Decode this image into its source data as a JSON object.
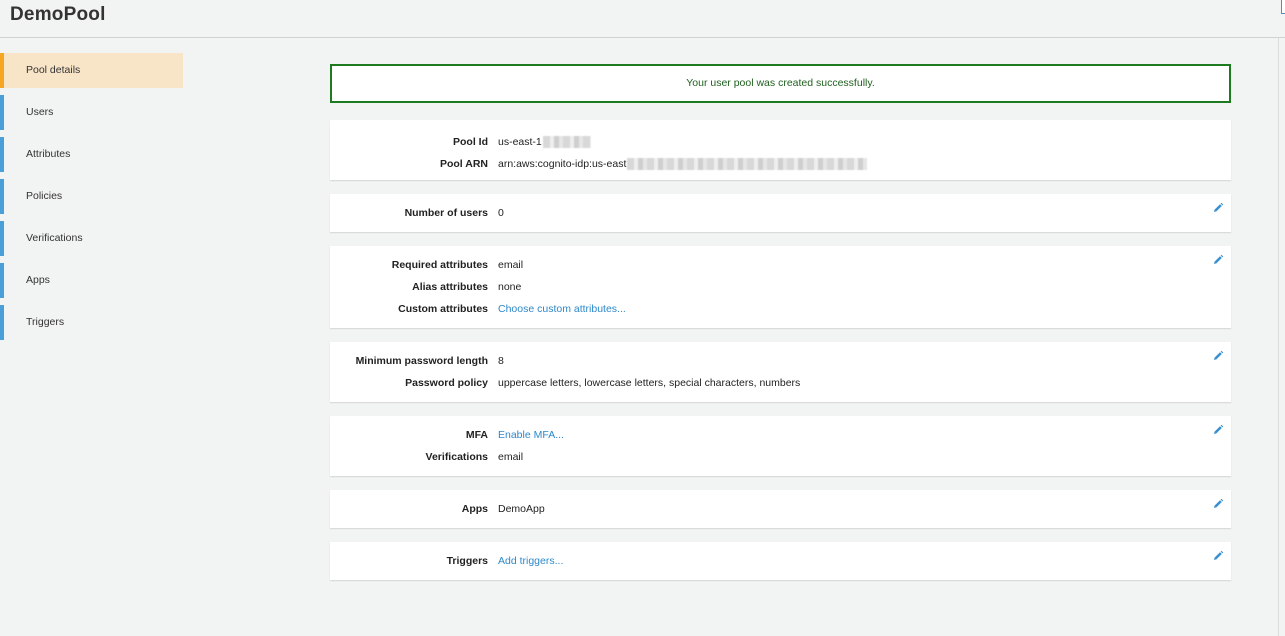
{
  "header": {
    "title": "DemoPool"
  },
  "sidebar": {
    "items": [
      {
        "label": "Pool details",
        "active": true
      },
      {
        "label": "Users"
      },
      {
        "label": "Attributes"
      },
      {
        "label": "Policies"
      },
      {
        "label": "Verifications"
      },
      {
        "label": "Apps"
      },
      {
        "label": "Triggers"
      }
    ]
  },
  "alert": {
    "message": "Your user pool was created successfully."
  },
  "pool": {
    "id_label": "Pool Id",
    "id_value": "us-east-1",
    "arn_label": "Pool ARN",
    "arn_value": "arn:aws:cognito-idp:us-east"
  },
  "users": {
    "label": "Number of users",
    "value": "0"
  },
  "attributes": {
    "required_label": "Required attributes",
    "required_value": "email",
    "alias_label": "Alias attributes",
    "alias_value": "none",
    "custom_label": "Custom attributes",
    "custom_link": "Choose custom attributes..."
  },
  "password": {
    "min_label": "Minimum password length",
    "min_value": "8",
    "policy_label": "Password policy",
    "policy_value": "uppercase letters, lowercase letters, special characters, numbers"
  },
  "mfa": {
    "mfa_label": "MFA",
    "mfa_link": "Enable MFA...",
    "verifications_label": "Verifications",
    "verifications_value": "email"
  },
  "apps": {
    "label": "Apps",
    "value": "DemoApp"
  },
  "triggers": {
    "label": "Triggers",
    "link": "Add triggers..."
  },
  "colors": {
    "accent": "#4a9fd8",
    "active": "#f5a623",
    "active_bg": "#f8e5c8",
    "success": "#1e7a1e",
    "link": "#2d88c9"
  },
  "icons": {
    "edit": "pencil-icon"
  }
}
